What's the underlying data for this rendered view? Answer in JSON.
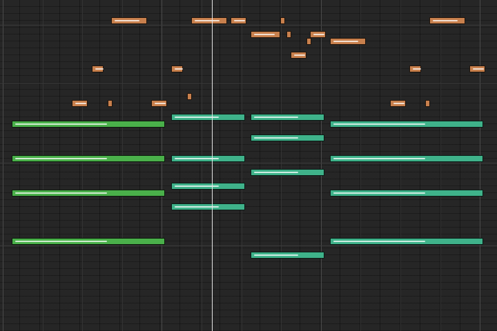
{
  "view": "piano-roll",
  "colors": {
    "background": "#262626",
    "lead_note": "#c8804d",
    "chord_green": "#4ab04a",
    "chord_teal": "#3fb28a",
    "playhead": "#e6e6e6"
  },
  "icons": [
    "playhead-marker"
  ],
  "playhead_beat": 10.6,
  "note_groups": [
    {
      "name": "lead",
      "color": "#c8804d",
      "notes": [
        {
          "start": 5.5,
          "length": 1.8,
          "pitch": 78
        },
        {
          "start": 9.5,
          "length": 1.8,
          "pitch": 78
        },
        {
          "start": 11.5,
          "length": 0.8,
          "pitch": 78
        },
        {
          "start": 14.0,
          "length": 0.2,
          "pitch": 78
        },
        {
          "start": 12.5,
          "length": 1.5,
          "pitch": 76
        },
        {
          "start": 14.3,
          "length": 0.2,
          "pitch": 76
        },
        {
          "start": 15.5,
          "length": 0.8,
          "pitch": 76
        },
        {
          "start": 15.3,
          "length": 0.2,
          "pitch": 75
        },
        {
          "start": 16.5,
          "length": 1.8,
          "pitch": 75
        },
        {
          "start": 14.5,
          "length": 0.8,
          "pitch": 73
        },
        {
          "start": 4.5,
          "length": 0.6,
          "pitch": 71
        },
        {
          "start": 8.5,
          "length": 0.6,
          "pitch": 71
        },
        {
          "start": 20.5,
          "length": 0.6,
          "pitch": 71
        },
        {
          "start": 23.5,
          "length": 0.8,
          "pitch": 71
        },
        {
          "start": 9.3,
          "length": 0.2,
          "pitch": 67
        },
        {
          "start": 3.5,
          "length": 0.8,
          "pitch": 66
        },
        {
          "start": 5.3,
          "length": 0.2,
          "pitch": 66
        },
        {
          "start": 7.5,
          "length": 0.8,
          "pitch": 66
        },
        {
          "start": 19.5,
          "length": 0.8,
          "pitch": 66
        },
        {
          "start": 21.3,
          "length": 0.2,
          "pitch": 66
        },
        {
          "start": 21.5,
          "length": 1.8,
          "pitch": 78
        }
      ]
    },
    {
      "name": "chords-1",
      "color": "#4ab04a",
      "notes": [
        {
          "start": 0.5,
          "length": 7.7,
          "pitch": 63
        },
        {
          "start": 0.5,
          "length": 7.7,
          "pitch": 58
        },
        {
          "start": 0.5,
          "length": 7.7,
          "pitch": 53
        },
        {
          "start": 0.5,
          "length": 7.7,
          "pitch": 46
        }
      ]
    },
    {
      "name": "chords-2",
      "color": "#3fb28a",
      "notes": [
        {
          "start": 8.5,
          "length": 3.7,
          "pitch": 64
        },
        {
          "start": 8.5,
          "length": 3.7,
          "pitch": 58
        },
        {
          "start": 8.5,
          "length": 3.7,
          "pitch": 54
        },
        {
          "start": 8.5,
          "length": 3.7,
          "pitch": 51
        },
        {
          "start": 12.5,
          "length": 3.7,
          "pitch": 64
        },
        {
          "start": 12.5,
          "length": 3.7,
          "pitch": 61
        },
        {
          "start": 12.5,
          "length": 3.7,
          "pitch": 56
        },
        {
          "start": 12.5,
          "length": 3.7,
          "pitch": 44
        },
        {
          "start": 16.5,
          "length": 7.7,
          "pitch": 63
        },
        {
          "start": 16.5,
          "length": 7.7,
          "pitch": 58
        },
        {
          "start": 16.5,
          "length": 7.7,
          "pitch": 53
        },
        {
          "start": 16.5,
          "length": 7.7,
          "pitch": 46
        }
      ]
    }
  ]
}
